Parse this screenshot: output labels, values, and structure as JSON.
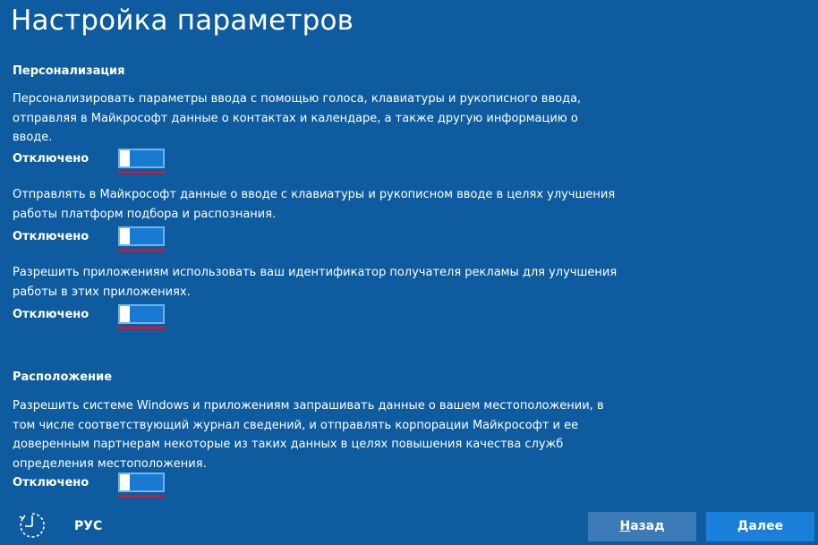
{
  "header": {
    "title": "Настройка параметров"
  },
  "personalization": {
    "heading": "Персонализация",
    "items": [
      {
        "description": "Персонализировать параметры ввода с помощью голоса, клавиатуры и рукописного ввода, отправляя в Майкрософт данные о контактах и календаре, а также другую информацию о вводе.",
        "state_label": "Отключено",
        "enabled": false
      },
      {
        "description": "Отправлять в Майкрософт данные о вводе с клавиатуры и рукописном вводе в целях улучшения работы платформ подбора и распознания.",
        "state_label": "Отключено",
        "enabled": false
      },
      {
        "description": "Разрешить приложениям использовать ваш идентификатор получателя рекламы для улучшения работы в этих приложениях.",
        "state_label": "Отключено",
        "enabled": false
      }
    ]
  },
  "location": {
    "heading": "Расположение",
    "items": [
      {
        "description": "Разрешить системе Windows и приложениям запрашивать данные о вашем местоположении, в том числе соответствующий журнал сведений, и отправлять корпорации Майкрософт и ее доверенным партнерам некоторые из таких данных в целях повышения качества служб определения местоположения.",
        "state_label": "Отключено",
        "enabled": false
      }
    ]
  },
  "footer": {
    "accessibility_icon": "ease-of-access-icon",
    "language": "РУС",
    "back_label_accel": "Н",
    "back_label_rest": "азад",
    "next_label": "Далее"
  },
  "colors": {
    "background": "#0e5c9f",
    "toggle_fill": "#1779d0",
    "highlight": "#d8142a"
  }
}
